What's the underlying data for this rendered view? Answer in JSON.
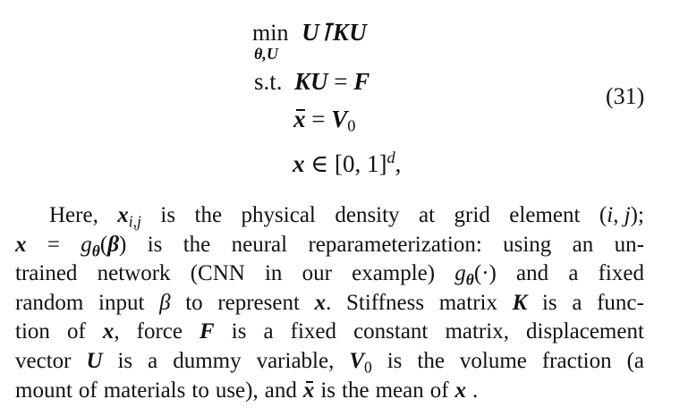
{
  "equation": {
    "min_operator": "min",
    "min_subscript": "θ,U",
    "objective": "U⊺KU",
    "constraint_label": "s.t.",
    "constraint1": "KU = F",
    "constraint2": "x̄ = V0",
    "constraint3": "x ∈ [0, 1]^d,",
    "number": "(31)"
  },
  "paragraph": {
    "lines": [
      "Here, x_{i,j} is the physical density at grid element (i, j);",
      "x = g_θ(β) is the neural reparameterization: using an un-",
      "trained network (CNN in our example) g_θ(·) and a fixed",
      "random input β to represent x. Stiffness matrix K is a func-",
      "tion of x, force F is a fixed constant matrix, displacement",
      "vector U is a dummy variable, V0 is the volume fraction (a",
      "mount of materials to use), and x̄ is the mean of x."
    ]
  }
}
